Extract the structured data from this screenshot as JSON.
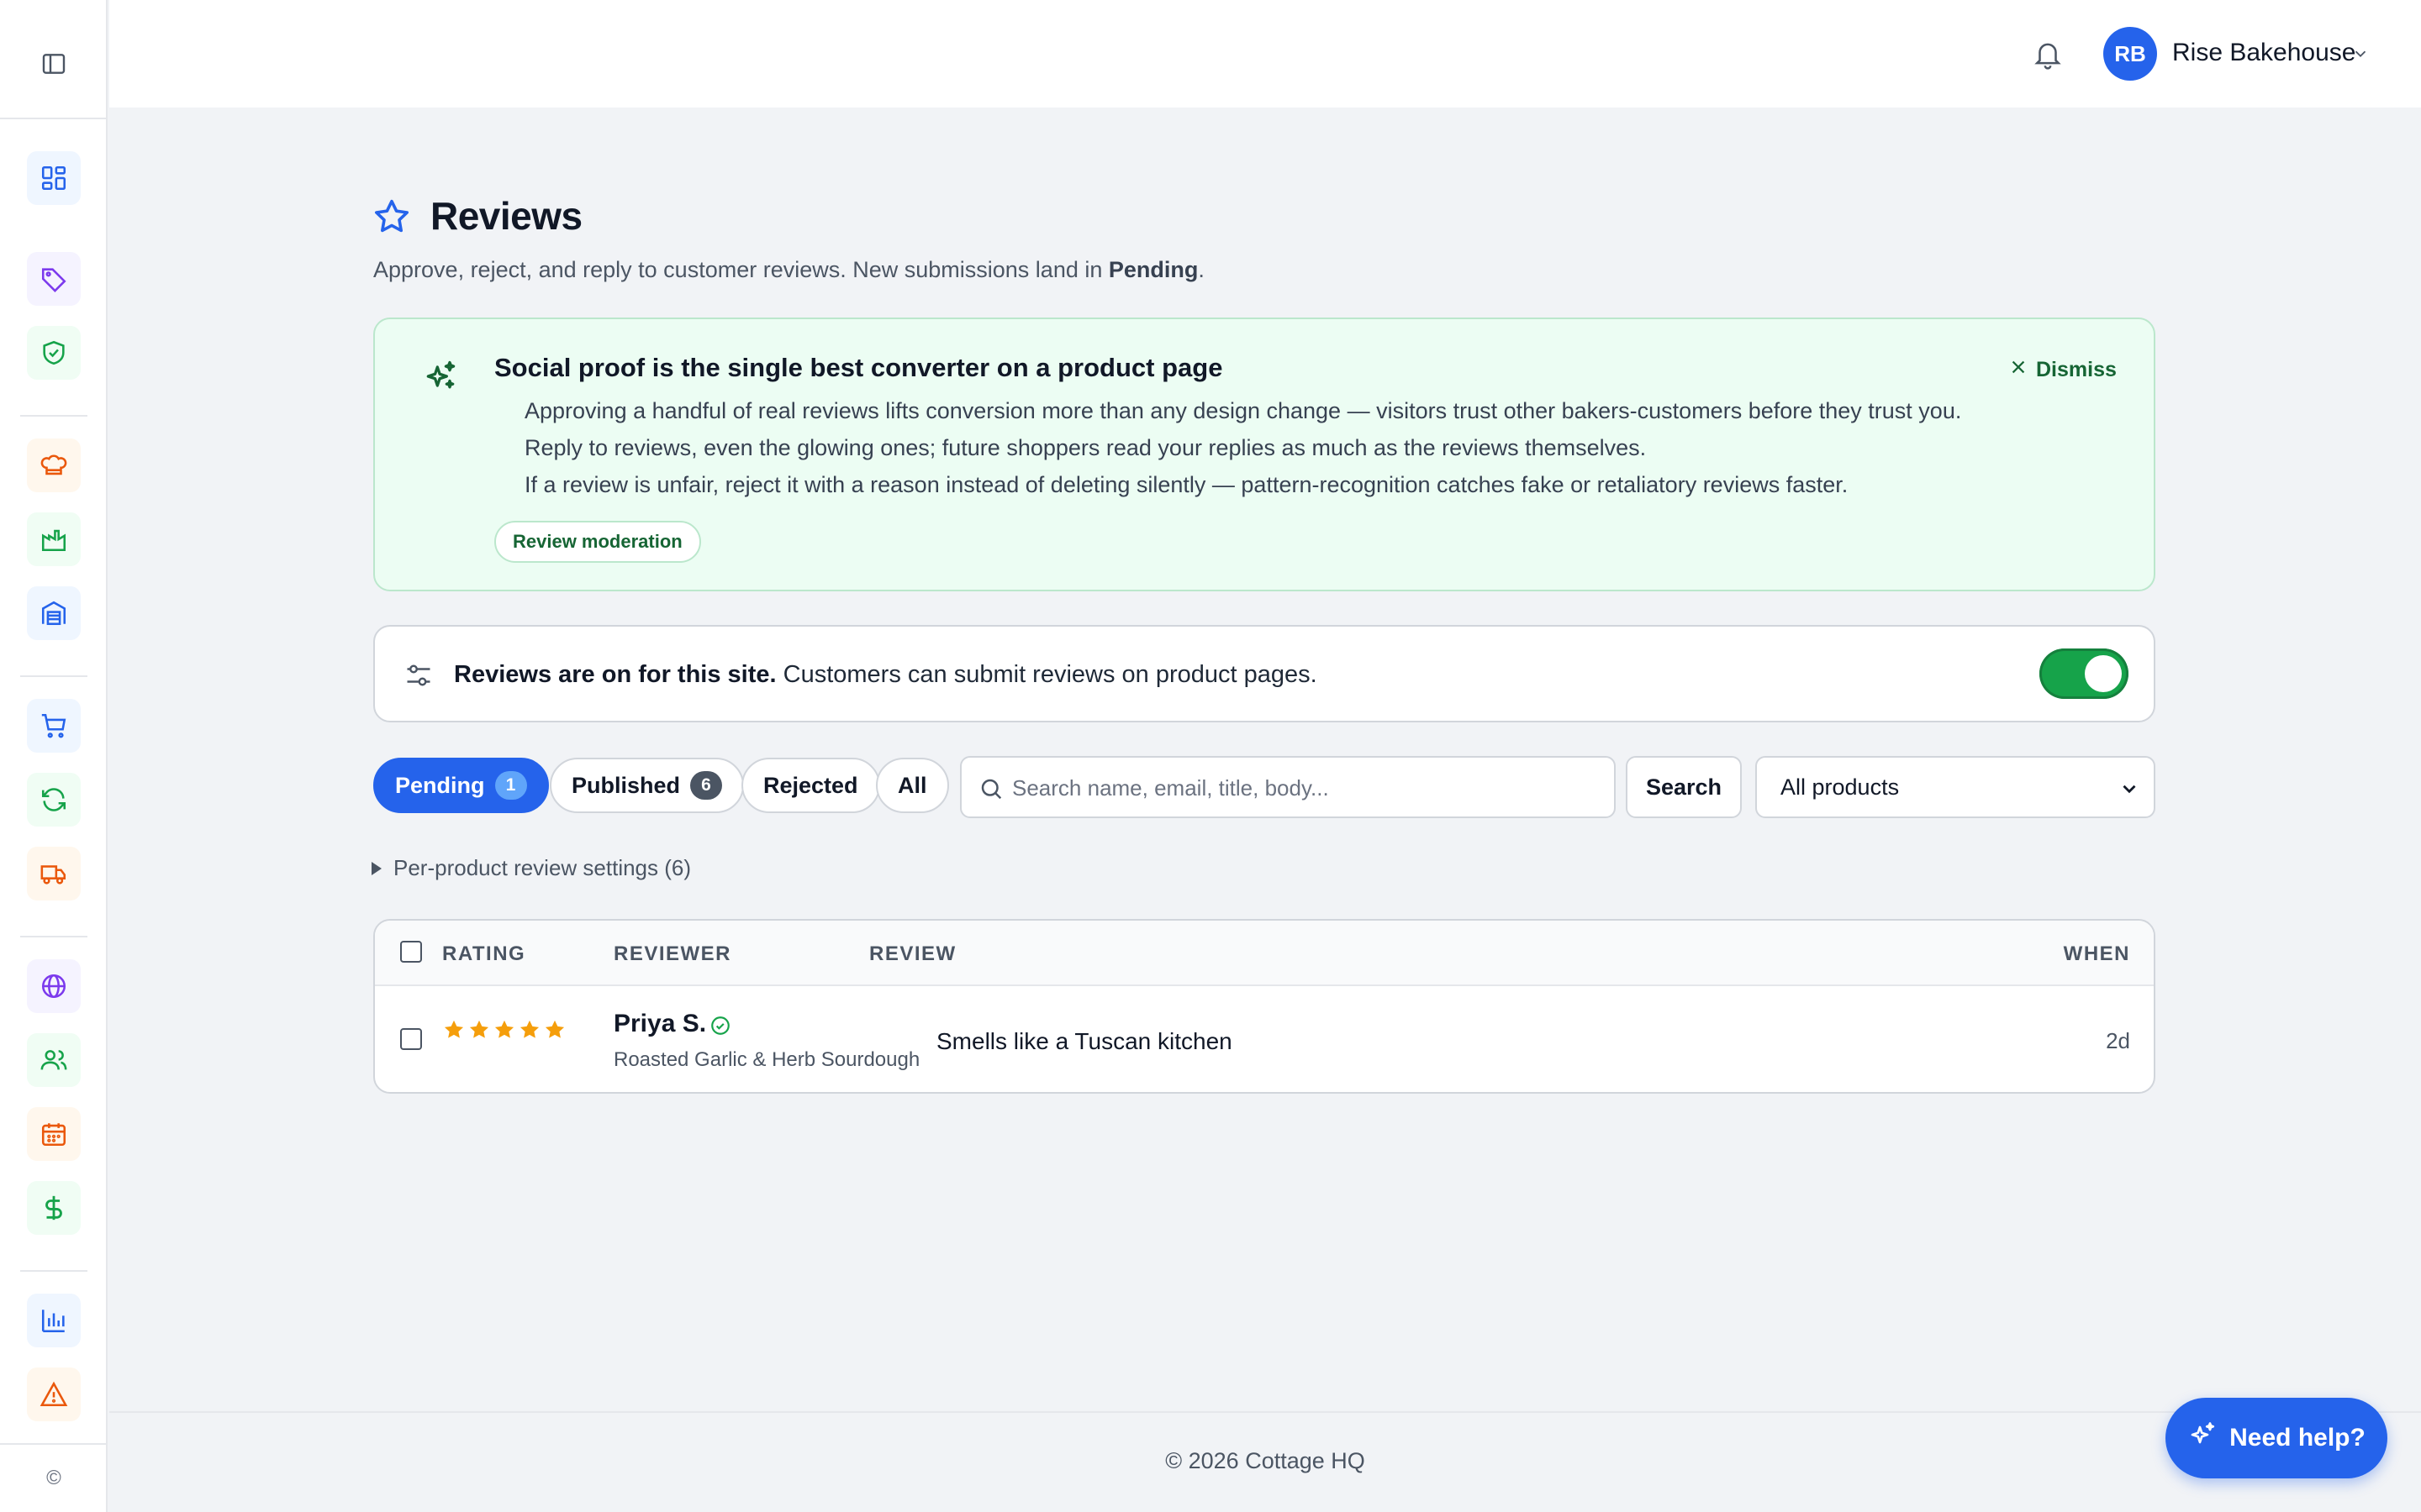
{
  "sidebar": {
    "toggle_icon": "sidebar-toggle-icon",
    "items": [
      {
        "name": "dashboard",
        "icon": "dashboard-grid-icon",
        "color": "#2563eb"
      },
      {
        "name": "tags",
        "icon": "tag-icon",
        "color": "#7c3aed"
      },
      {
        "name": "security",
        "icon": "shield-check-icon",
        "color": "#16a34a"
      },
      {
        "name": "baking",
        "icon": "chef-hat-icon",
        "color": "#ea580c"
      },
      {
        "name": "production",
        "icon": "factory-icon",
        "color": "#16a34a"
      },
      {
        "name": "warehouse",
        "icon": "warehouse-icon",
        "color": "#2563eb"
      },
      {
        "name": "orders",
        "icon": "cart-icon",
        "color": "#2563eb"
      },
      {
        "name": "subscriptions",
        "icon": "refresh-icon",
        "color": "#16a34a"
      },
      {
        "name": "delivery",
        "icon": "truck-icon",
        "color": "#ea580c"
      },
      {
        "name": "website",
        "icon": "globe-icon",
        "color": "#7c3aed"
      },
      {
        "name": "customers",
        "icon": "users-icon",
        "color": "#16a34a"
      },
      {
        "name": "calendar",
        "icon": "calendar-icon",
        "color": "#ea580c"
      },
      {
        "name": "finance",
        "icon": "dollar-icon",
        "color": "#16a34a"
      },
      {
        "name": "reports",
        "icon": "bar-chart-icon",
        "color": "#2563eb"
      },
      {
        "name": "alerts",
        "icon": "warning-icon",
        "color": "#ea580c"
      }
    ],
    "copyright_symbol": "©"
  },
  "topbar": {
    "avatar_initials": "RB",
    "account_name": "Rise Bakehouse"
  },
  "page": {
    "title": "Reviews",
    "subtitle_pre": "Approve, reject, and reply to customer reviews. New submissions land in ",
    "subtitle_bold": "Pending",
    "subtitle_post": "."
  },
  "tip": {
    "title": "Social proof is the single best converter on a product page",
    "lines": [
      "Approving a handful of real reviews lifts conversion more than any design change — visitors trust other bakers-customers before they trust you.",
      "Reply to reviews, even the glowing ones; future shoppers read your replies as much as the reviews themselves.",
      "If a review is unfair, reject it with a reason instead of deleting silently — pattern-recognition catches fake or retaliatory reviews faster."
    ],
    "chip": "Review moderation",
    "dismiss": "Dismiss"
  },
  "reviews_toggle": {
    "bold": "Reviews are on for this site.",
    "text": " Customers can submit reviews on product pages.",
    "enabled": true
  },
  "filters": {
    "tabs": [
      {
        "label": "Pending",
        "count": "1",
        "active": true
      },
      {
        "label": "Published",
        "count": "6",
        "active": false
      },
      {
        "label": "Rejected",
        "count": null,
        "active": false
      },
      {
        "label": "All",
        "count": null,
        "active": false
      }
    ],
    "search_placeholder": "Search name, email, title, body...",
    "search_button": "Search",
    "product_select": "All products"
  },
  "per_product": "Per-product review settings (6)",
  "table": {
    "columns": [
      "RATING",
      "REVIEWER",
      "REVIEW",
      "WHEN"
    ],
    "rows": [
      {
        "rating": 5,
        "reviewer": "Priya S.",
        "verified": true,
        "product": "Roasted Garlic & Herb Sourdough",
        "review": "Smells like a Tuscan kitchen",
        "when": "2d"
      }
    ]
  },
  "footer": "© 2026 Cottage HQ",
  "help_button": "Need help?",
  "colors": {
    "accent": "#2563eb",
    "success": "#16a34a",
    "star": "#f59e0b",
    "tip_bg": "#ecfdf3"
  }
}
